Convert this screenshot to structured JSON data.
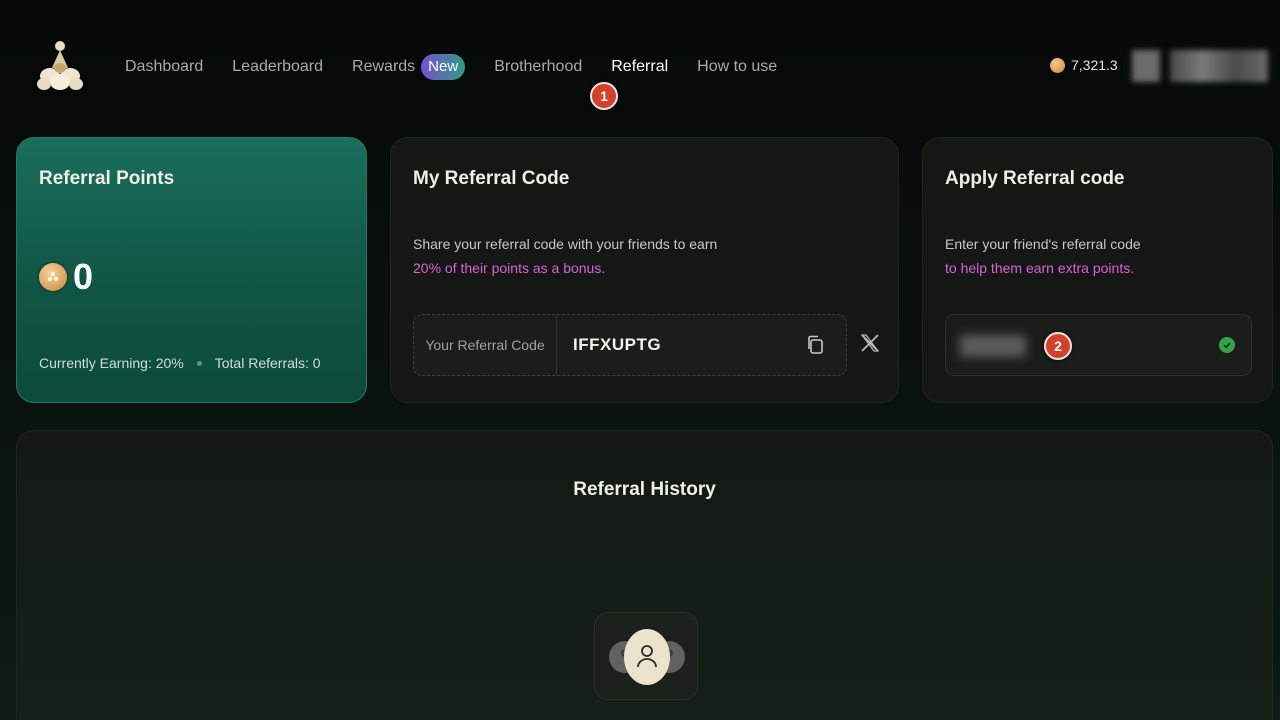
{
  "nav": {
    "items": [
      {
        "label": "Dashboard"
      },
      {
        "label": "Leaderboard"
      },
      {
        "label": "Rewards",
        "badge": "New"
      },
      {
        "label": "Brotherhood"
      },
      {
        "label": "Referral",
        "active": true
      },
      {
        "label": "How to use"
      }
    ]
  },
  "header": {
    "balance": "7,321.3"
  },
  "markers": {
    "step1": "1",
    "step2": "2"
  },
  "points_card": {
    "title": "Referral Points",
    "value": "0",
    "earning": "Currently Earning: 20%",
    "total": "Total Referrals: 0"
  },
  "my_code_card": {
    "title": "My Referral Code",
    "desc": "Share your referral code with your friends to earn",
    "highlight": "20% of their points as a bonus.",
    "code_label": "Your Referral Code",
    "code_value": "IFFXUPTG"
  },
  "apply_card": {
    "title": "Apply Referral code",
    "desc": "Enter your friend's referral code",
    "highlight": "to help them earn extra points."
  },
  "history": {
    "title": "Referral History"
  },
  "colors": {
    "accent_green": "#115746",
    "highlight_pink": "#d763d9",
    "marker_red": "#d2412c",
    "success": "#34a34a"
  }
}
